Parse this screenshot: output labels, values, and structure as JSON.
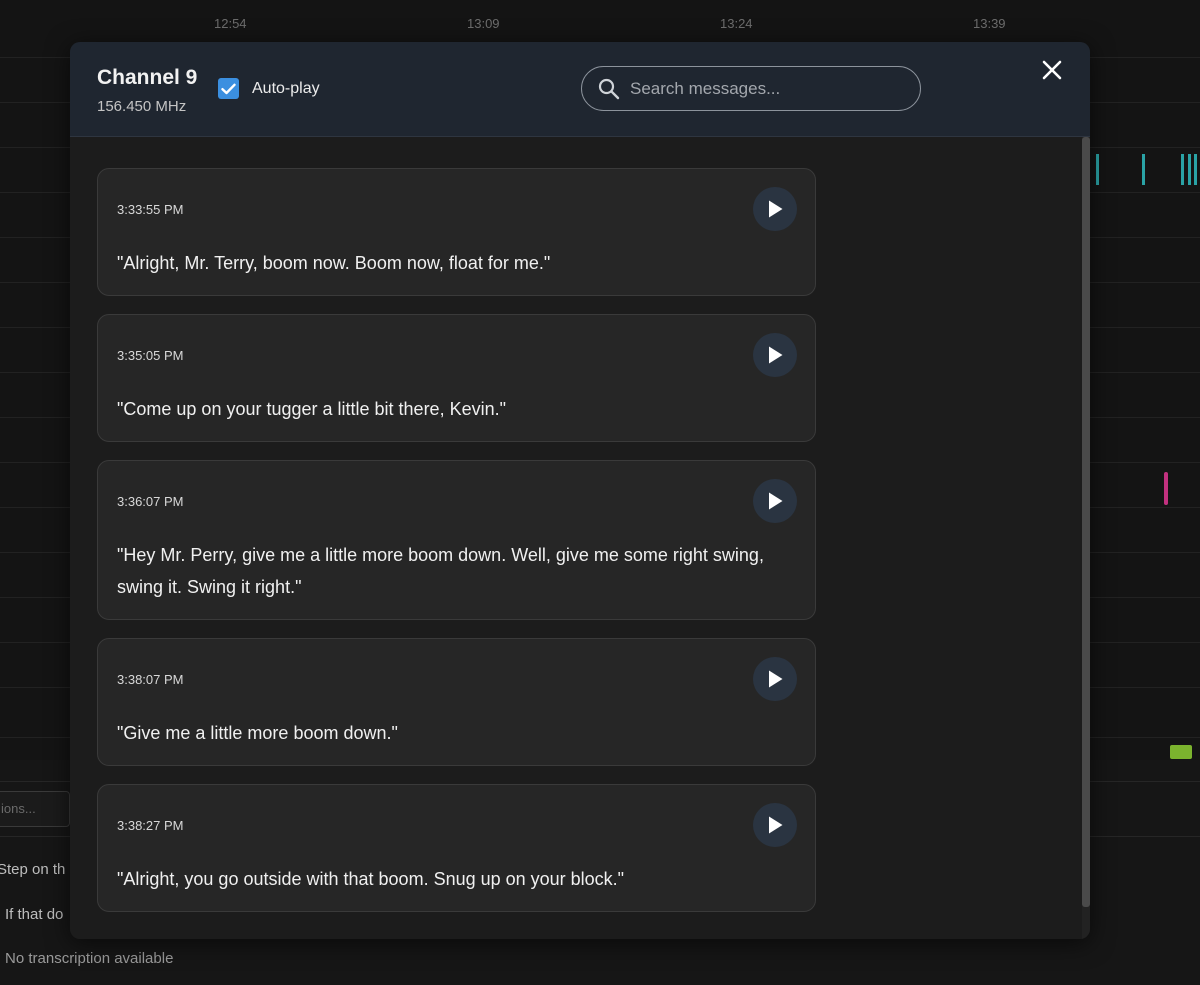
{
  "background": {
    "timeline_labels": [
      "12:54",
      "13:09",
      "13:24",
      "13:39"
    ],
    "search_placeholder_fragment": "ions...",
    "transcript_lines": [
      "Step on th",
      "If that do",
      "No transcription available"
    ],
    "colors": {
      "teal_marks": "#2aa3a6",
      "magenta_mark": "#c2317f",
      "green_mark": "#7bb32e"
    }
  },
  "modal": {
    "channel_name": "Channel 9",
    "frequency": "156.450 MHz",
    "autoplay_label": "Auto-play",
    "autoplay_checked": true,
    "search_placeholder": "Search messages...",
    "accent_color": "#3b8fe0",
    "messages": [
      {
        "time": "3:33:55 PM",
        "text": "\"Alright, Mr. Terry, boom now. Boom now, float for me.\""
      },
      {
        "time": "3:35:05 PM",
        "text": "\"Come up on your tugger a little bit there, Kevin.\""
      },
      {
        "time": "3:36:07 PM",
        "text": "\"Hey Mr. Perry, give me a little more boom down. Well, give me some right swing, swing it. Swing it right.\""
      },
      {
        "time": "3:38:07 PM",
        "text": "\"Give me a little more boom down.\""
      },
      {
        "time": "3:38:27 PM",
        "text": "\"Alright, you go outside with that boom. Snug up on your block.\""
      }
    ]
  }
}
